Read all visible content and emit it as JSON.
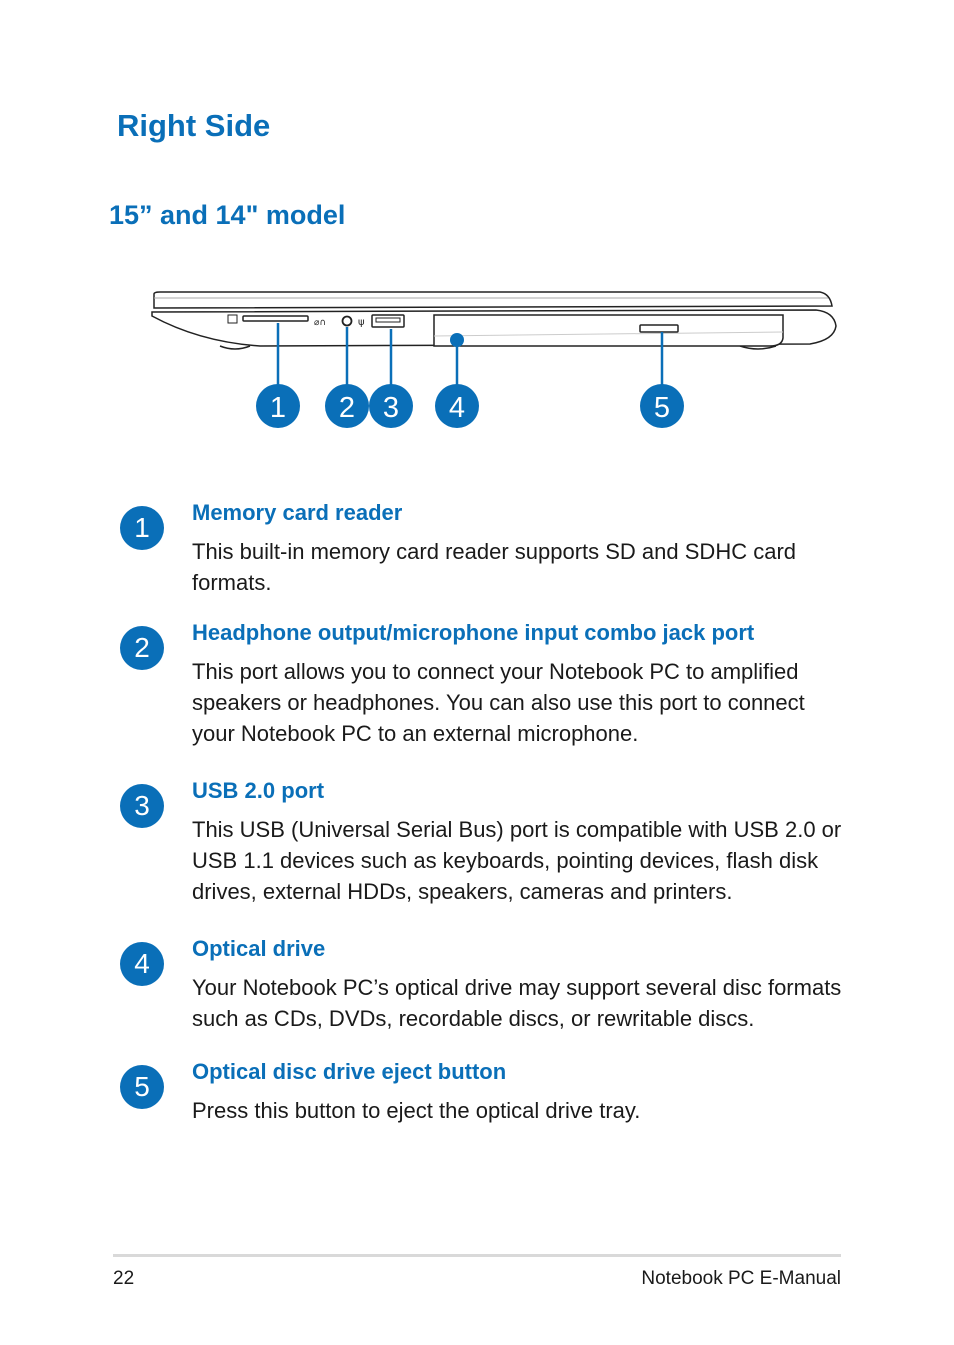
{
  "page": {
    "heading": "Right Side",
    "subheading": "15” and 14\" model"
  },
  "diagram": {
    "callouts": [
      "1",
      "2",
      "3",
      "4",
      "5"
    ],
    "accent_color": "#0a6fb8"
  },
  "items": [
    {
      "number": "1",
      "title": "Memory card reader",
      "description": "This built-in memory card reader supports SD and SDHC card formats."
    },
    {
      "number": "2",
      "title": "Headphone output/microphone input combo jack port",
      "description": "This port allows you to connect your Notebook PC to amplified speakers or headphones. You can also use this port to connect your Notebook PC to an external microphone."
    },
    {
      "number": "3",
      "title": "USB 2.0 port",
      "description": "This USB (Universal Serial Bus) port is compatible with USB 2.0 or USB 1.1 devices such as keyboards, pointing devices, flash disk drives, external HDDs, speakers, cameras and printers."
    },
    {
      "number": "4",
      "title": "Optical drive",
      "description": "Your Notebook PC’s optical drive may support several disc formats such as CDs, DVDs, recordable discs, or rewritable discs."
    },
    {
      "number": "5",
      "title": "Optical disc drive eject button",
      "description": "Press this button to eject the optical drive tray."
    }
  ],
  "footer": {
    "page_number": "22",
    "manual_title": "Notebook PC E-Manual"
  }
}
